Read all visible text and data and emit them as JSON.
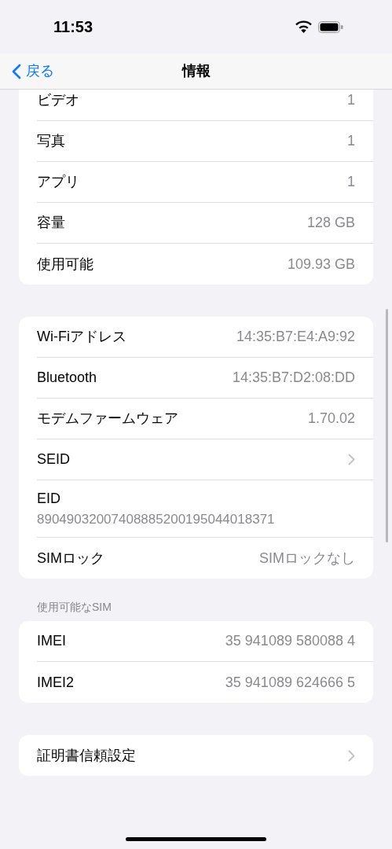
{
  "status_bar": {
    "time": "11:53"
  },
  "nav": {
    "back": "戻る",
    "title": "情報"
  },
  "sections": [
    {
      "rows": [
        {
          "kind": "value",
          "label": "ビデオ",
          "value": "1"
        },
        {
          "kind": "value",
          "label": "写真",
          "value": "1"
        },
        {
          "kind": "value",
          "label": "アプリ",
          "value": "1"
        },
        {
          "kind": "value",
          "label": "容量",
          "value": "128 GB"
        },
        {
          "kind": "value",
          "label": "使用可能",
          "value": "109.93 GB"
        }
      ]
    },
    {
      "rows": [
        {
          "kind": "value",
          "label": "Wi-Fiアドレス",
          "value": "14:35:B7:E4:A9:92"
        },
        {
          "kind": "value",
          "label": "Bluetooth",
          "value": "14:35:B7:D2:08:DD"
        },
        {
          "kind": "value",
          "label": "モデムファームウェア",
          "value": "1.70.02"
        },
        {
          "kind": "chevron",
          "label": "SEID"
        },
        {
          "kind": "stacked",
          "label": "EID",
          "value": "89049032007408885200195044018371"
        },
        {
          "kind": "value",
          "label": "SIMロック",
          "value": "SIMロックなし"
        }
      ]
    },
    {
      "header": "使用可能なSIM",
      "rows": [
        {
          "kind": "value",
          "label": "IMEI",
          "value": "35 941089 580088 4"
        },
        {
          "kind": "value",
          "label": "IMEI2",
          "value": "35 941089 624666 5"
        }
      ]
    },
    {
      "rows": [
        {
          "kind": "chevron",
          "label": "証明書信頼設定"
        }
      ]
    }
  ]
}
